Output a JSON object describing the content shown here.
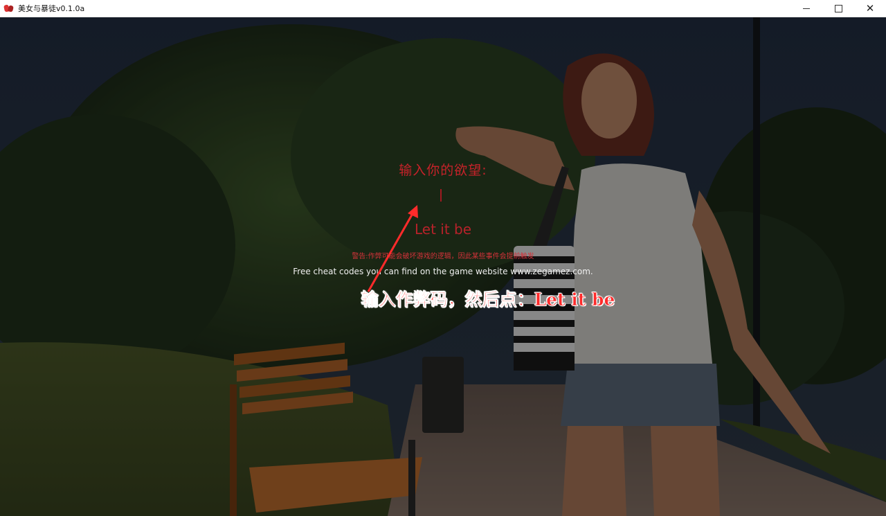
{
  "window": {
    "title": "美女与暴徒v0.1.0a",
    "controls": {
      "minimize": "—",
      "maximize": "□",
      "close": "✕"
    }
  },
  "cheat_dialog": {
    "title": "输入你的欲望:",
    "input_value": "",
    "confirm_label": "Let it be",
    "warning": "警告:作弊可能会破坏游戏的逻辑，因此某些事件会提前触发",
    "info": "Free cheat codes you can find on the game website www.zegamez.com."
  },
  "annotation": {
    "text": "输入作弊码，然后点：Let it be",
    "color": "#ff2b2b"
  },
  "colors": {
    "dialog_text": "#c8222a",
    "info_text": "#f0f0f0"
  }
}
